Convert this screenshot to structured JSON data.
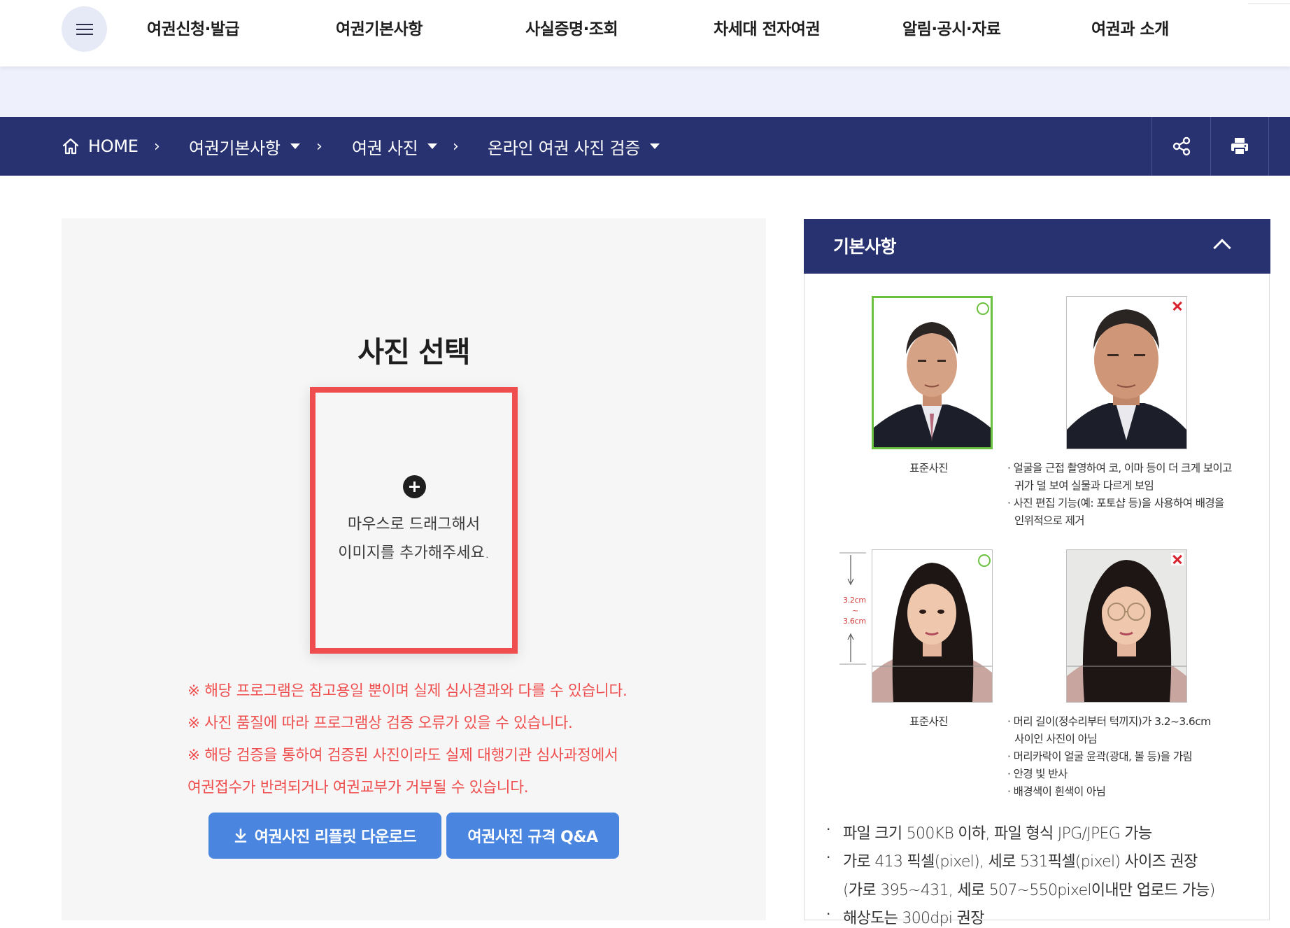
{
  "topnav": {
    "menu_icon": "hamburger-icon",
    "items": [
      {
        "label": "여권신청·발급"
      },
      {
        "label": "여권기본사항"
      },
      {
        "label": "사실증명·조회"
      },
      {
        "label": "차세대 전자여권"
      },
      {
        "label": "알림·공시·자료"
      },
      {
        "label": "여권과 소개"
      }
    ]
  },
  "breadcrumb": {
    "home_label": "HOME",
    "items": [
      {
        "label": "여권기본사항"
      },
      {
        "label": "여권 사진"
      },
      {
        "label": "온라인 여권 사진 검증"
      }
    ],
    "share_icon": "share-icon",
    "print_icon": "printer-icon"
  },
  "upload": {
    "title": "사진 선택",
    "dropzone_line1": "마우스로 드래그해서",
    "dropzone_line2": "이미지를 추가해주세요.",
    "notices": [
      "※ 해당 프로그램은 참고용일 뿐이며 실제 심사결과와 다를 수 있습니다.",
      "※ 사진 품질에 따라 프로그램상 검증 오류가 있을 수 있습니다.",
      "※ 해당 검증을 통하여 검증된 사진이라도 실제 대행기관 심사과정에서",
      "여권접수가 반려되거나 여권교부가 거부될 수 있습니다."
    ],
    "download_button": "여권사진 리플릿 다운로드",
    "qa_button": "여권사진 규격 Q&A"
  },
  "basics": {
    "title": "기본사항",
    "row1": {
      "good_caption": "표준사진",
      "bad_notes": [
        "· 얼굴을 근접 촬영하여 코, 이마 등이 더 크게 보이고",
        "귀가 덜 보여 실물과 다르게 보임",
        "· 사진 편집 기능(예: 포토샵 등)을 사용하여 배경을",
        "인위적으로 제거"
      ]
    },
    "row2": {
      "measure_top": "3.2cm",
      "measure_mid": "~",
      "measure_bottom": "3.6cm",
      "good_caption": "표준사진",
      "bad_notes": [
        "· 머리 길이(정수리부터 턱끼지)가 3.2~3.6cm",
        "사이인 사진이 아님",
        "· 머리카락이 얼굴 윤곽(광대, 볼 등)을 가림",
        "· 안경 빛 반사",
        "· 배경색이 흰색이 아님"
      ]
    },
    "rules": [
      "파일 크기 500KB 이하, 파일 형식 JPG/JPEG 가능",
      "가로 413 픽셀(pixel), 세로 531픽셀(pixel) 사이즈 권장",
      "(가로 395~431, 세로 507~550pixel이내만 업로드 가능)",
      "해상도는 300dpi 권장"
    ]
  },
  "colors": {
    "navy": "#283270",
    "accent_blue": "#4a86e0",
    "warning_red": "#ef4e4e",
    "ok_green": "#6ac13e",
    "bad_red": "#d8242e"
  }
}
